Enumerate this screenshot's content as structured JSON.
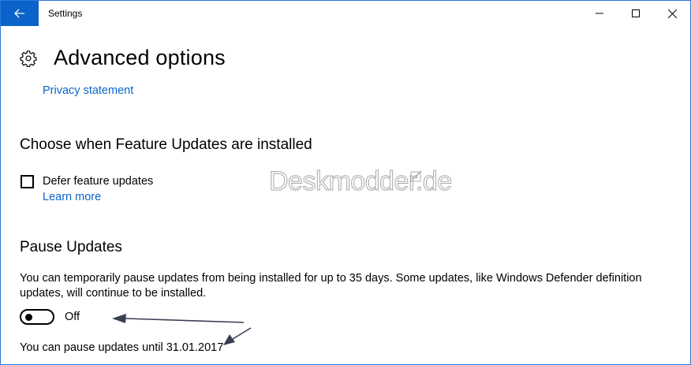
{
  "window": {
    "title": "Settings"
  },
  "titlebar": {
    "back_icon": "back-arrow-icon",
    "minimize_icon": "minimize-icon",
    "maximize_icon": "maximize-icon",
    "close_icon": "close-icon",
    "accent": "#0a63c9"
  },
  "page": {
    "title": "Advanced options",
    "icon": "gear-icon"
  },
  "privacy": {
    "link": "Privacy statement"
  },
  "feature_updates": {
    "heading": "Choose when Feature Updates are installed",
    "defer_label": "Defer feature updates",
    "defer_checked": false,
    "learn_more": "Learn more"
  },
  "watermark": {
    "text": "Deskmodder.de"
  },
  "pause": {
    "heading": "Pause Updates",
    "description": "You can temporarily pause updates from being installed for up to 35 days. Some updates, like Windows Defender definition updates, will continue to be installed.",
    "toggle_state": "Off",
    "until_text": "You can pause updates until 31.01.2017"
  },
  "annotations": {
    "arrow_color": "#3a3f52"
  }
}
